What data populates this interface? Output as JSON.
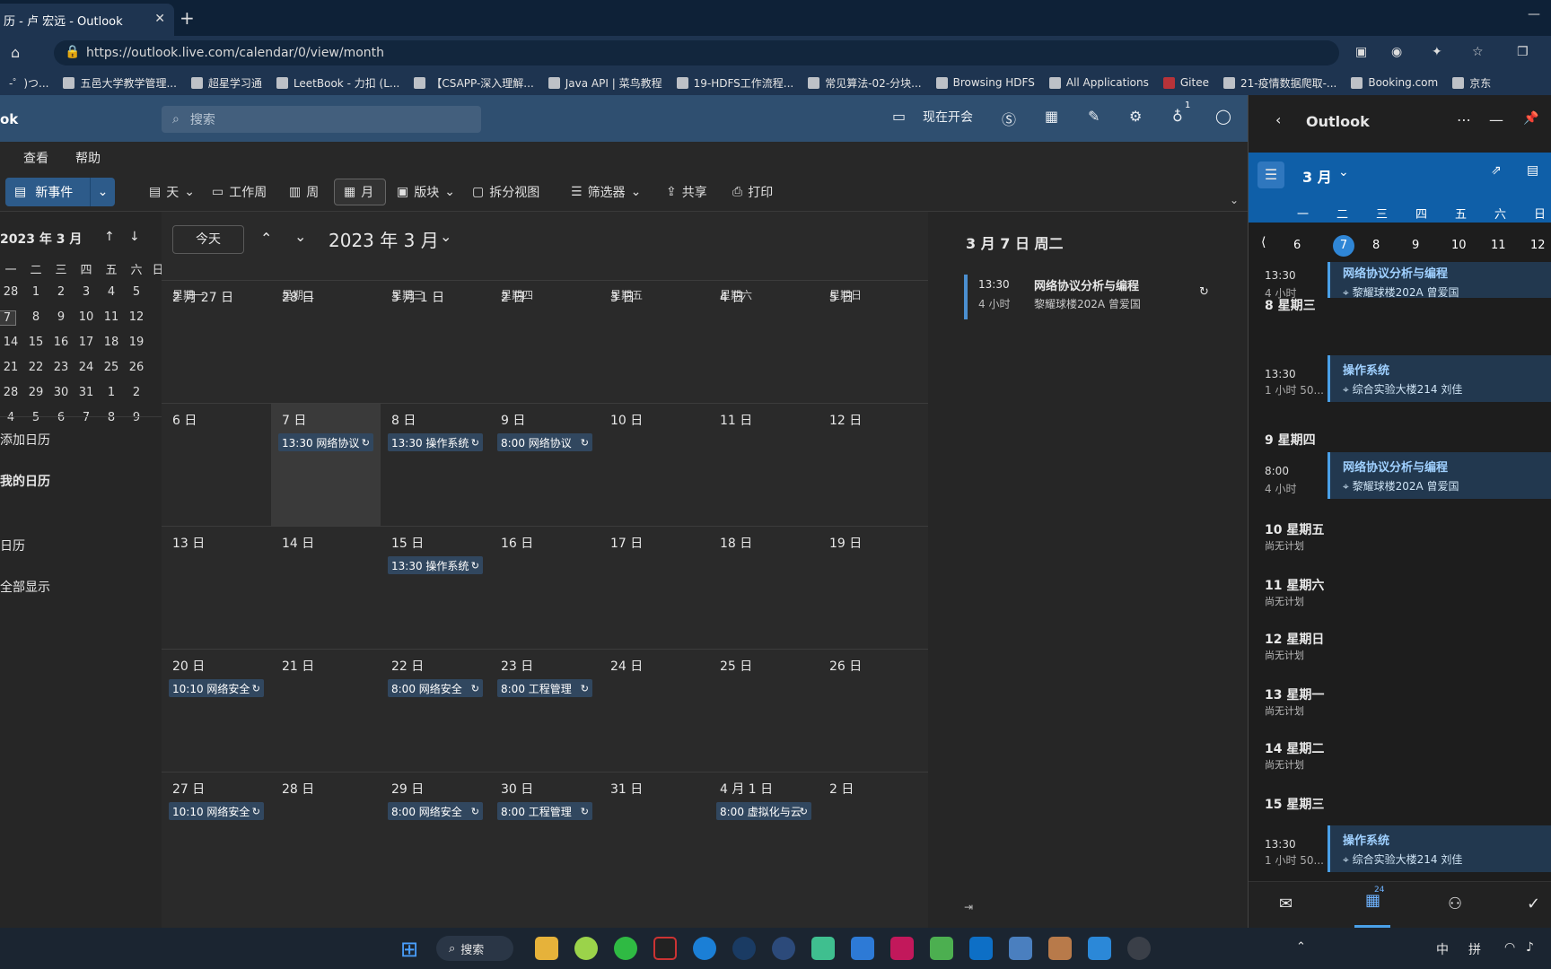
{
  "browser": {
    "tab_title": "历 - 卢 宏远 - Outlook",
    "url": "https://outlook.live.com/calendar/0/view/month",
    "bookmarks": [
      "-゜)つ...",
      "五邑大学教学管理...",
      "超星学习通",
      "LeetBook - 力扣 (L...",
      "【CSAPP-深入理解...",
      "Java API | 菜鸟教程",
      "19-HDFS工作流程...",
      "常见算法-02-分块...",
      "Browsing HDFS",
      "All Applications",
      "Gitee",
      "21-疫情数据爬取-...",
      "Booking.com",
      "京东"
    ]
  },
  "header": {
    "brand": "ok",
    "search_placeholder": "搜索",
    "meet_now": "现在开会",
    "badge": "1"
  },
  "menu": {
    "view": "查看",
    "help": "帮助"
  },
  "toolbar": {
    "new_event": "新事件",
    "day": "天",
    "workweek": "工作周",
    "week": "周",
    "month": "月",
    "board": "版块",
    "split": "拆分视图",
    "filter": "筛选器",
    "share": "共享",
    "print": "打印"
  },
  "mini_cal": {
    "title": "2023 年 3 月",
    "dow": [
      "二",
      "三",
      "四",
      "五",
      "六",
      "日"
    ],
    "first_col": "一",
    "rows": [
      [
        "28",
        "1",
        "2",
        "3",
        "4",
        "5"
      ],
      [
        "7",
        "8",
        "9",
        "10",
        "11",
        "12"
      ],
      [
        "14",
        "15",
        "16",
        "17",
        "18",
        "19"
      ],
      [
        "21",
        "22",
        "23",
        "24",
        "25",
        "26"
      ],
      [
        "28",
        "29",
        "30",
        "31",
        "1",
        "2"
      ],
      [
        "4",
        "5",
        "6",
        "7",
        "8",
        "9"
      ]
    ]
  },
  "left_nav": {
    "add_calendar": "添加日历",
    "my_calendars": "我的日历",
    "calendar": "日历",
    "show_all": "全部显示"
  },
  "month": {
    "today": "今天",
    "title": "2023 年 3 月",
    "weekdays": [
      "星期一",
      "星期二",
      "星期三",
      "星期四",
      "星期五",
      "星期六",
      "星期日"
    ],
    "weeks": [
      [
        {
          "d": "2 月 27 日"
        },
        {
          "d": "28 日"
        },
        {
          "d": "3 月 1 日"
        },
        {
          "d": "2 日"
        },
        {
          "d": "3 日"
        },
        {
          "d": "4 日"
        },
        {
          "d": "5 日"
        }
      ],
      [
        {
          "d": "6 日"
        },
        {
          "d": "7 日",
          "ev": "13:30 网络协议"
        },
        {
          "d": "8 日",
          "ev": "13:30 操作系统"
        },
        {
          "d": "9 日",
          "ev": "8:00 网络协议"
        },
        {
          "d": "10 日"
        },
        {
          "d": "11 日"
        },
        {
          "d": "12 日"
        }
      ],
      [
        {
          "d": "13 日"
        },
        {
          "d": "14 日"
        },
        {
          "d": "15 日",
          "ev": "13:30 操作系统"
        },
        {
          "d": "16 日"
        },
        {
          "d": "17 日"
        },
        {
          "d": "18 日"
        },
        {
          "d": "19 日"
        }
      ],
      [
        {
          "d": "20 日",
          "ev": "10:10 网络安全"
        },
        {
          "d": "21 日"
        },
        {
          "d": "22 日",
          "ev": "8:00 网络安全"
        },
        {
          "d": "23 日",
          "ev": "8:00 工程管理"
        },
        {
          "d": "24 日"
        },
        {
          "d": "25 日"
        },
        {
          "d": "26 日"
        }
      ],
      [
        {
          "d": "27 日",
          "ev": "10:10 网络安全"
        },
        {
          "d": "28 日"
        },
        {
          "d": "29 日",
          "ev": "8:00 网络安全"
        },
        {
          "d": "30 日",
          "ev": "8:00 工程管理"
        },
        {
          "d": "31 日"
        },
        {
          "d": "4 月 1 日",
          "ev": "8:00 虚拟化与云"
        },
        {
          "d": "2 日"
        }
      ]
    ]
  },
  "detail": {
    "date": "3 月 7 日 周二",
    "time": "13:30",
    "duration": "4 小时",
    "title": "网络协议分析与编程",
    "location": "黎耀球楼202A 曾爱国"
  },
  "side": {
    "app": "Outlook",
    "month": "3 月",
    "dow": [
      "一",
      "二",
      "三",
      "四",
      "五",
      "六",
      "日"
    ],
    "days": [
      "6",
      "7",
      "8",
      "9",
      "10",
      "11",
      "12"
    ],
    "agenda": {
      "e1_time": "13:30",
      "e1_dur": "4 小时",
      "e1_title": "网络协议分析与编程",
      "e1_loc": "黎耀球楼202A 曾爱国",
      "g8": "8 星期三",
      "e2_time": "13:30",
      "e2_dur": "1 小时 50...",
      "e2_title": "操作系统",
      "e2_loc": "综合实验大楼214 刘佳",
      "g9": "9 星期四",
      "e3_time": "8:00",
      "e3_dur": "4 小时",
      "e3_title": "网络协议分析与编程",
      "e3_loc": "黎耀球楼202A 曾爱国",
      "g10": "10 星期五",
      "g11": "11 星期六",
      "g12": "12 星期日",
      "g13": "13 星期一",
      "g14": "14 星期二",
      "empty": "尚无计划",
      "g15": "15 星期三",
      "e4_time": "13:30",
      "e4_dur": "1 小时 50...",
      "e4_title": "操作系统",
      "e4_loc": "综合实验大楼214 刘佳"
    },
    "tab_badge": "24"
  },
  "taskbar": {
    "search": "搜索",
    "ime1": "中",
    "ime2": "拼"
  }
}
